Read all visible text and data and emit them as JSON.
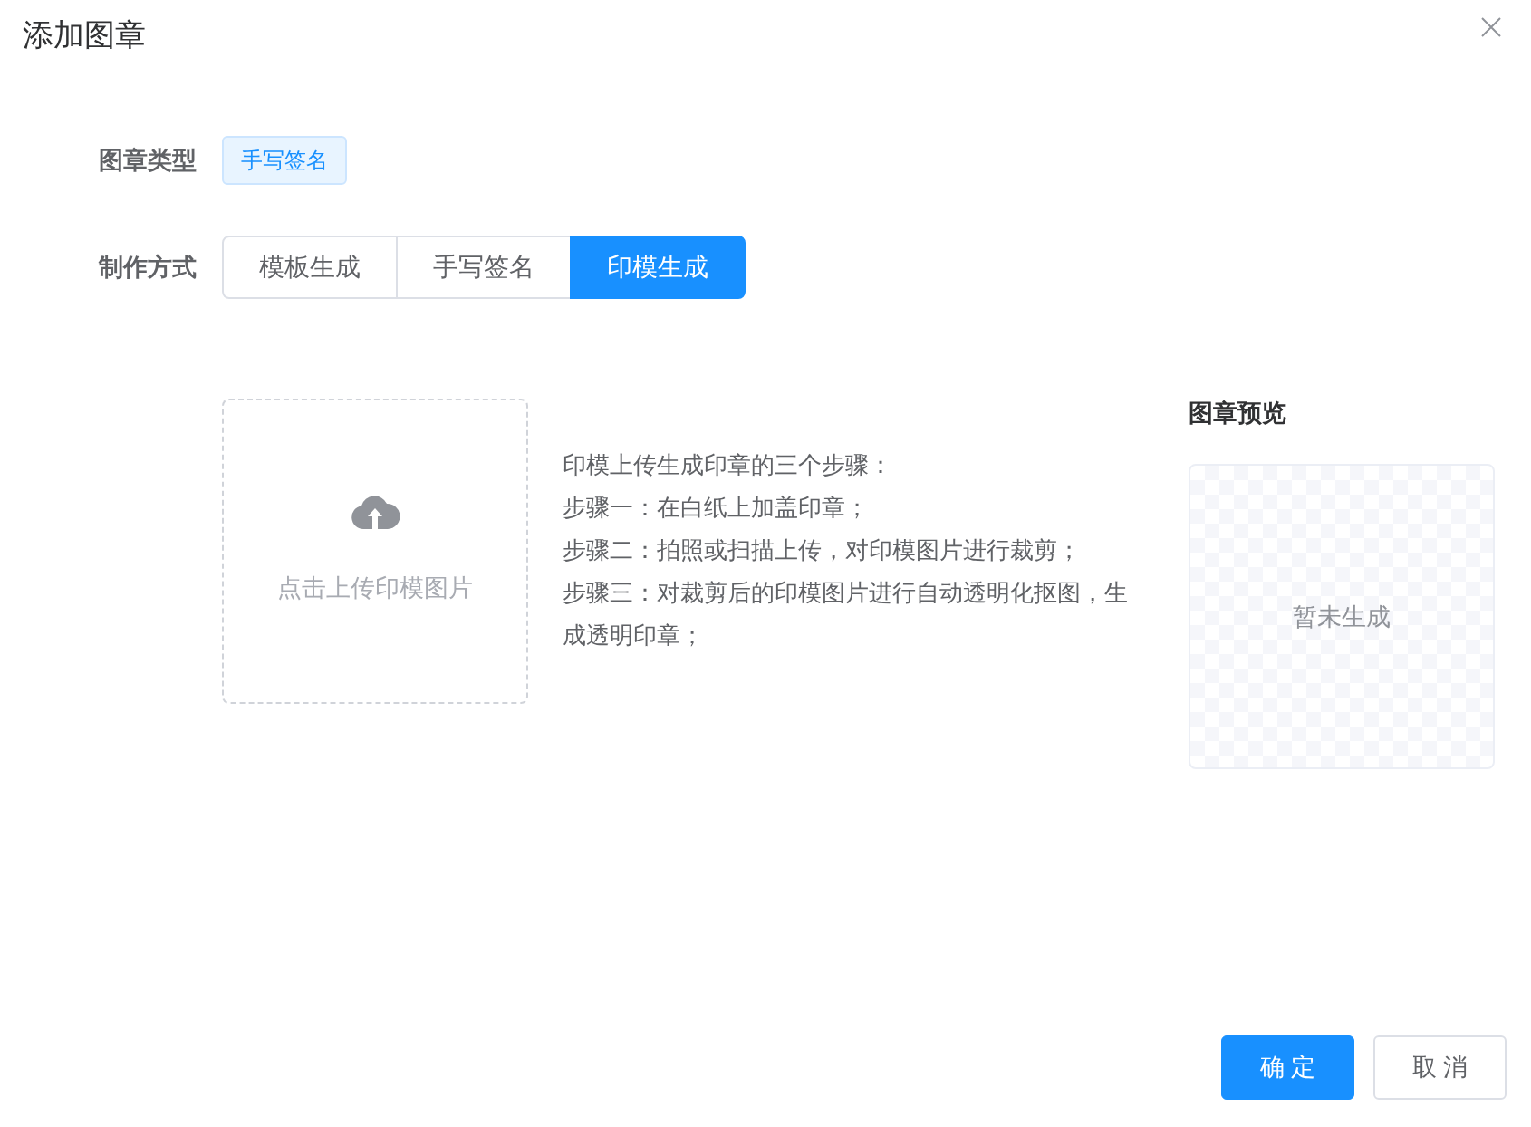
{
  "dialog": {
    "title": "添加图章"
  },
  "form": {
    "stamp_type": {
      "label": "图章类型",
      "tag": "手写签名"
    },
    "method": {
      "label": "制作方式",
      "options": [
        {
          "label": "模板生成",
          "selected": false
        },
        {
          "label": "手写签名",
          "selected": false
        },
        {
          "label": "印模生成",
          "selected": true
        }
      ]
    }
  },
  "upload": {
    "hint": "点击上传印模图片"
  },
  "instructions": [
    "印模上传生成印章的三个步骤：",
    "步骤一：在白纸上加盖印章；",
    "步骤二：拍照或扫描上传，对印模图片进行裁剪；",
    "步骤三：对裁剪后的印模图片进行自动透明化抠图，生成透明印章；"
  ],
  "preview": {
    "title": "图章预览",
    "empty_text": "暂未生成"
  },
  "buttons": [
    {
      "label": "确 定",
      "kind": "primary"
    },
    {
      "label": "取 消",
      "kind": "default"
    }
  ]
}
